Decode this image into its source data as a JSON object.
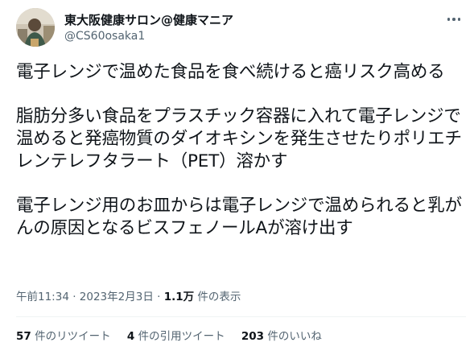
{
  "author": {
    "display_name": "東大阪健康サロン@健康マニア",
    "handle": "@CS60osaka1",
    "avatar": "profile-photo"
  },
  "menu_icon": "more-horizontal-icon",
  "tweet": {
    "paragraphs": [
      "電子レンジで温めた食品を食べ続けると癌リスク高める",
      "脂肪分多い食品をプラスチック容器に入れて電子レンジで温めると発癌物質のダイオキシンを発生させたりポリエチレンテレフタラート（PET）溶かす",
      "電子レンジ用のお皿からは電子レンジで温められると乳がんの原因となるビスフェノールAが溶け出す"
    ]
  },
  "meta": {
    "time": "午前11:34",
    "separator": " · ",
    "date": "2023年2月3日",
    "views_count": "1.1万",
    "views_label": "件の表示"
  },
  "stats": {
    "retweets_count": "57",
    "retweets_label": "件のリツイート",
    "quotes_count": "4",
    "quotes_label": "件の引用ツイート",
    "likes_count": "203",
    "likes_label": "件のいいね"
  },
  "colors": {
    "text": "#0f1419",
    "secondary": "#536471",
    "divider": "#eff3f4"
  }
}
